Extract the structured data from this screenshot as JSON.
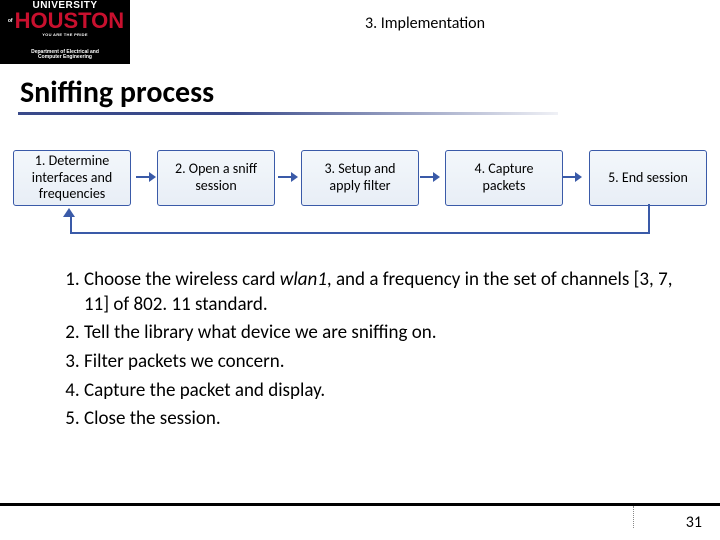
{
  "header": {
    "university_line1_left": "UNIVERSITY",
    "university_of": "of",
    "houston_word": "HOUSTON",
    "pride_line": "YOU ARE THE PRIDE",
    "department_line1": "Department of Electrical and",
    "department_line2": "Computer Engineering",
    "section_label": "3. Implementation"
  },
  "title": "Sniffing process",
  "steps": [
    "1. Determine interfaces and frequencies",
    "2. Open a sniff session",
    "3. Setup and apply filter",
    "4. Capture packets",
    "5. End session"
  ],
  "body": {
    "items": [
      {
        "pre": "Choose the wireless card ",
        "em": "wlan1",
        "post": ", and a frequency in the set of channels [3, 7, 11] of 802. 11 standard."
      },
      {
        "pre": "Tell the library what device we are sniffing on.",
        "em": "",
        "post": ""
      },
      {
        "pre": "Filter packets we concern.",
        "em": "",
        "post": ""
      },
      {
        "pre": "Capture the packet and display.",
        "em": "",
        "post": ""
      },
      {
        "pre": "Close the session.",
        "em": "",
        "post": ""
      }
    ]
  },
  "page_number": "31"
}
